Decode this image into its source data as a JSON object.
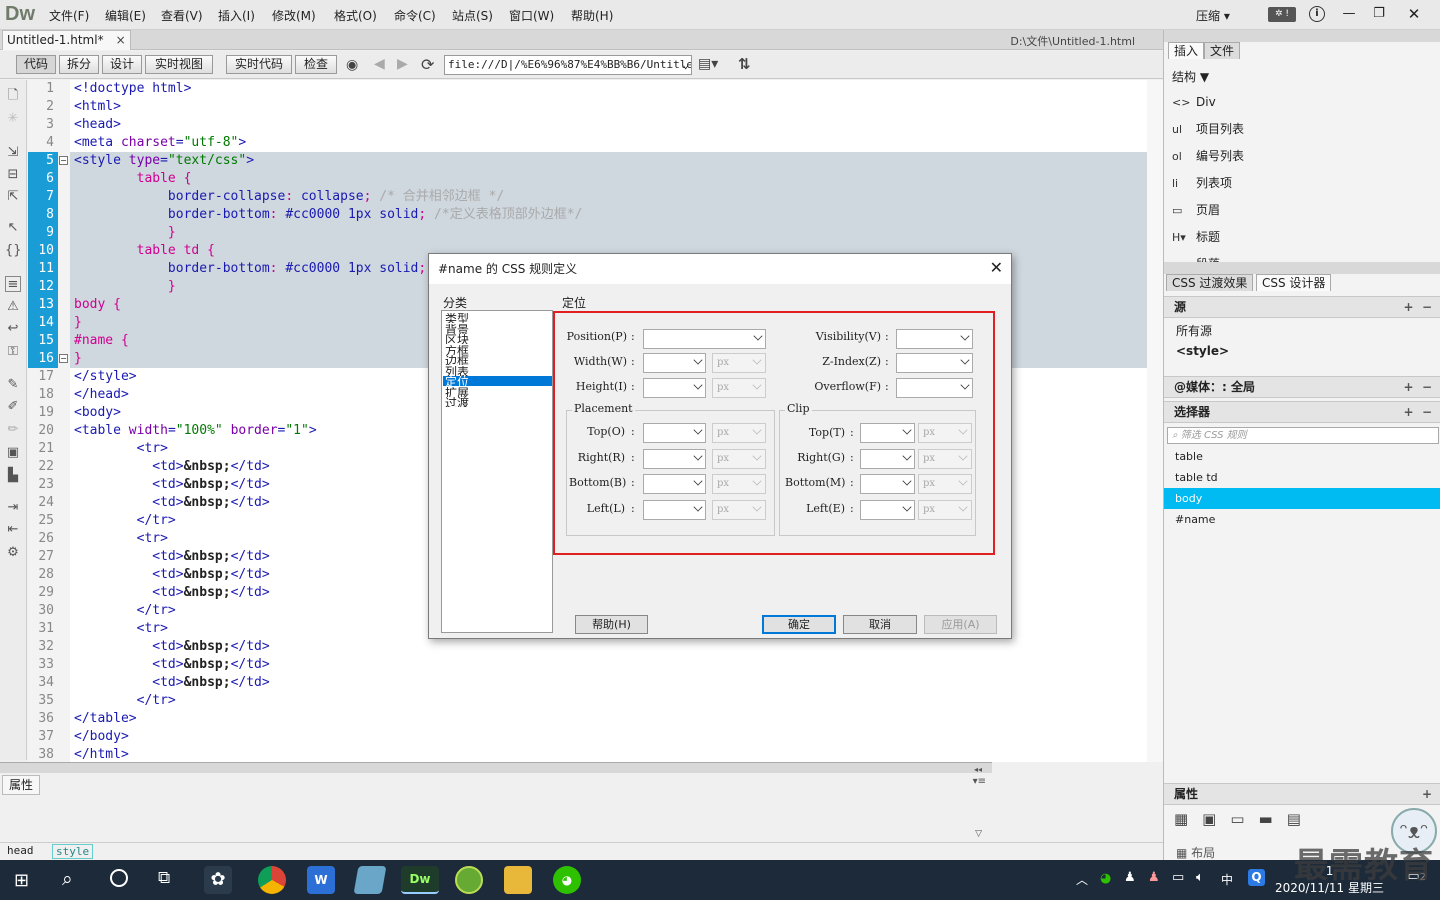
{
  "app": {
    "logo": "Dw",
    "compress": "压缩 ▾"
  },
  "menu": [
    "文件(F)",
    "编辑(E)",
    "查看(V)",
    "插入(I)",
    "修改(M)",
    "格式(O)",
    "命令(C)",
    "站点(S)",
    "窗口(W)",
    "帮助(H)"
  ],
  "doc": {
    "tab": "Untitled-1.html*",
    "close": "×",
    "path": "D:\\文件\\Untitled-1.html"
  },
  "toolbar": {
    "views": [
      "代码",
      "拆分",
      "设计",
      "实时视图"
    ],
    "live_code": "实时代码",
    "inspect": "检查",
    "address": "file:///D|/%E6%96%87%E4%BB%B6/Untitled"
  },
  "code": {
    "line_numbers": [
      "1",
      "2",
      "3",
      "4",
      "5",
      "6",
      "7",
      "8",
      "9",
      "10",
      "11",
      "12",
      "13",
      "14",
      "15",
      "16",
      "17",
      "18",
      "19",
      "20",
      "21",
      "22",
      "23",
      "24",
      "25",
      "26",
      "27",
      "28",
      "29",
      "30",
      "31",
      "32",
      "33",
      "34",
      "35",
      "36",
      "37",
      "38"
    ],
    "selected_lines": [
      5,
      6,
      7,
      8,
      9,
      10,
      11,
      12,
      13,
      14,
      15,
      16
    ]
  },
  "properties": {
    "tab": "属性"
  },
  "status": {
    "crumbs": [
      "head",
      "style"
    ]
  },
  "right_panel": {
    "tabs": [
      "插入",
      "文件"
    ],
    "structure": "结构",
    "insert_items": [
      {
        "icon": "<>",
        "label": "Div"
      },
      {
        "icon": "ul",
        "label": "项目列表"
      },
      {
        "icon": "ol",
        "label": "编号列表"
      },
      {
        "icon": "li",
        "label": "列表项"
      },
      {
        "icon": "▭",
        "label": "页眉"
      },
      {
        "icon": "H▾",
        "label": "标题"
      },
      {
        "icon": "▭",
        "label": "段落"
      }
    ],
    "css_tabs": [
      "CSS 过渡效果",
      "CSS 设计器"
    ],
    "sources_header": "源",
    "sources": [
      "所有源",
      "<style>"
    ],
    "media_header": "@媒体：: 全局",
    "selectors_header": "选择器",
    "filter_placeholder": "筛选 CSS 规则",
    "selectors": [
      "table",
      "table td",
      "body",
      "#name"
    ],
    "active_selector": "body",
    "props_header": "属性",
    "layout_label": "布局"
  },
  "dialog": {
    "title": "#name 的 CSS 规则定义",
    "category_label": "分类",
    "section_label": "定位",
    "categories": [
      "类型",
      "背景",
      "区块",
      "方框",
      "边框",
      "列表",
      "定位",
      "扩展",
      "过渡"
    ],
    "selected_category": "定位",
    "fields": {
      "position": "Position(P)",
      "width": "Width(W)",
      "height": "Height(I)",
      "visibility": "Visibility(V)",
      "zindex": "Z-Index(Z)",
      "overflow": "Overflow(F)",
      "placement": "Placement",
      "clip": "Clip",
      "p_top": "Top(O)",
      "p_right": "Right(R)",
      "p_bottom": "Bottom(B)",
      "p_left": "Left(L)",
      "c_top": "Top(T)",
      "c_right": "Right(G)",
      "c_bottom": "Bottom(M)",
      "c_left": "Left(E)",
      "unit": "px"
    },
    "buttons": {
      "help": "帮助(H)",
      "ok": "确定",
      "cancel": "取消",
      "apply": "应用(A)"
    }
  },
  "taskbar": {
    "time": "1",
    "date": "2020/11/11 星期三",
    "ime": "中",
    "notif": "2"
  },
  "watermark": "最需教育",
  "colors": {
    "selection_blue": "#1a9cd6",
    "active_selector": "#00baf2",
    "red_highlight": "#e02020",
    "taskbar": "#1c2a3a"
  }
}
